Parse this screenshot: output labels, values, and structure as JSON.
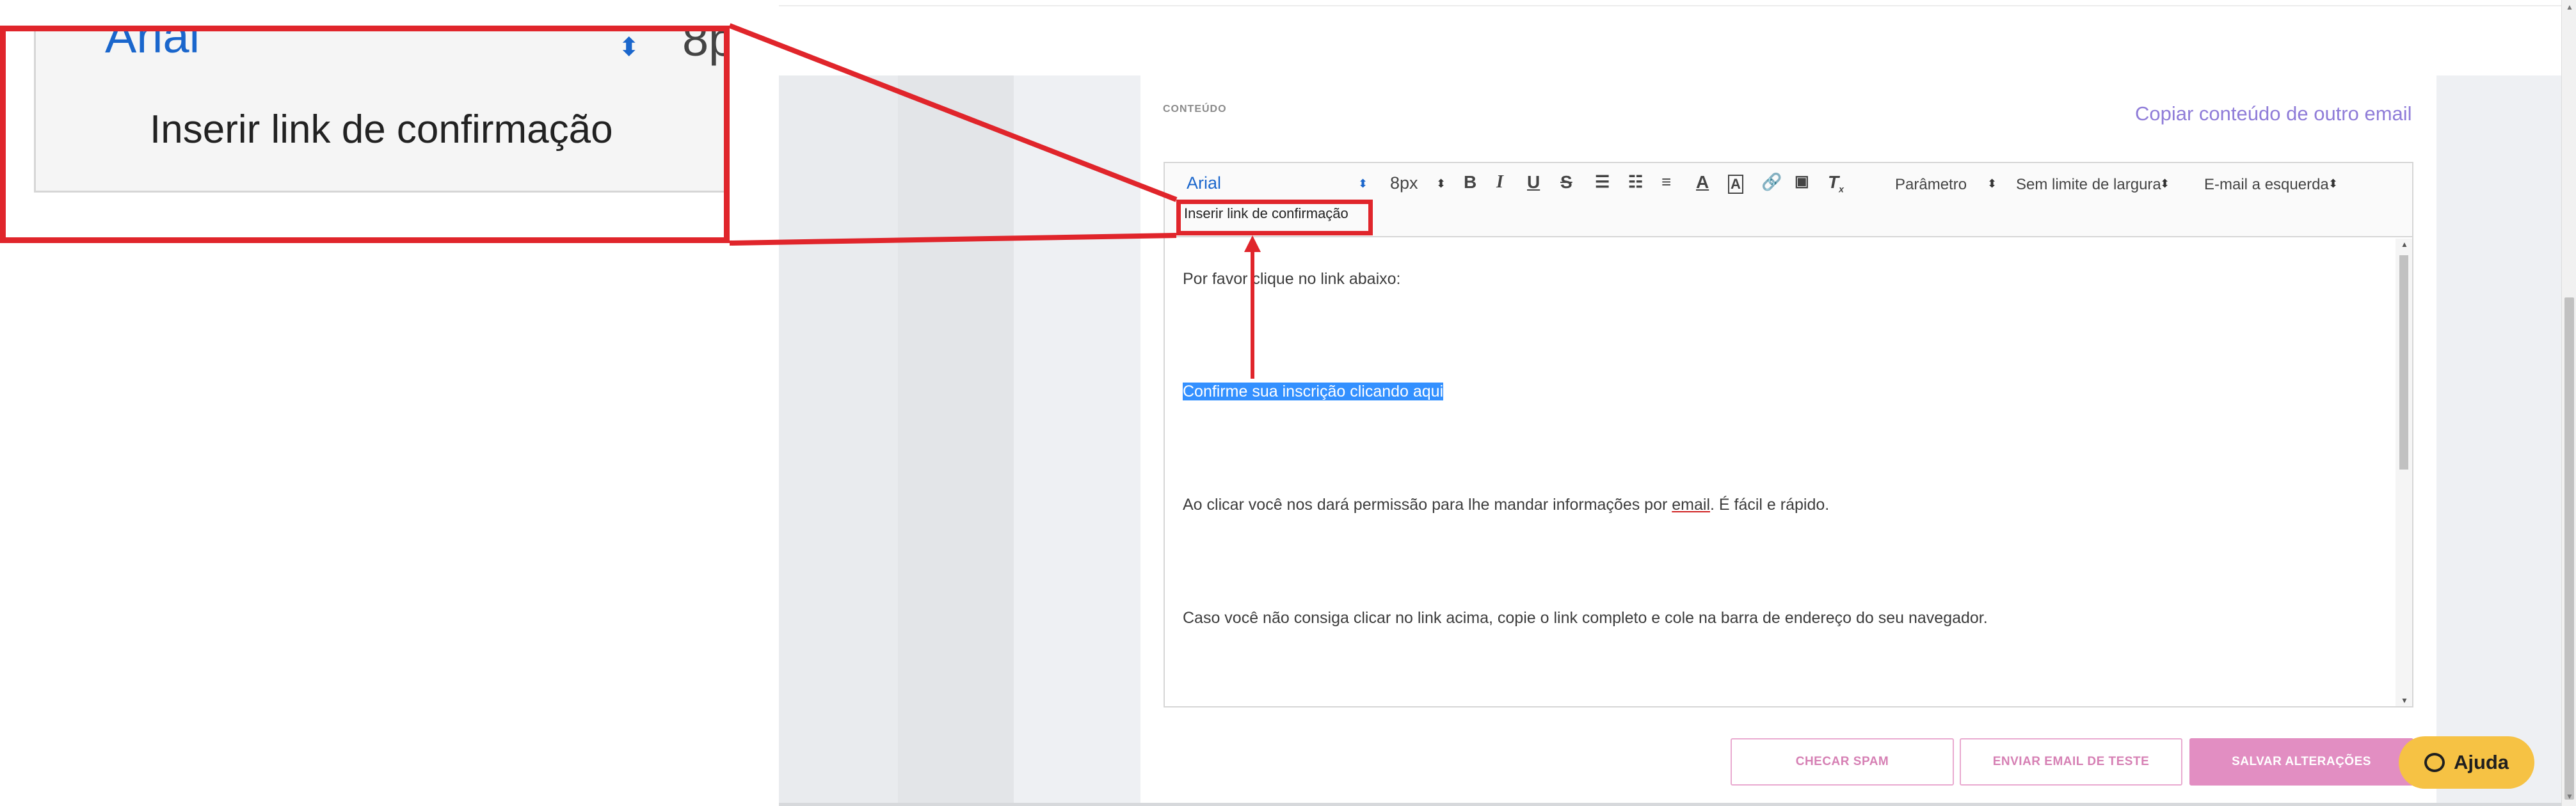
{
  "section": {
    "label": "CONTEÚDO",
    "copy_link": "Copiar conteúdo de outro email"
  },
  "toolbar": {
    "font": "Arial",
    "size": "8px",
    "param": "Parâmetro",
    "width": "Sem limite de largura",
    "align": "E-mail a esquerda",
    "insert_confirm": "Inserir link de confirmação"
  },
  "content": {
    "p1": "Por favor clique no link abaixo:",
    "p2": "Confirme sua inscrição clicando aqui",
    "p3_before": "Ao clicar você nos dará permissão para lhe mandar informações por ",
    "p3_email": "email",
    "p3_after": ". É fácil e rápido.",
    "p4": "Caso você não consiga clicar no link acima, copie o link completo e cole na barra de endereço do seu navegador."
  },
  "buttons": {
    "spam": "CHECAR SPAM",
    "test": "ENVIAR EMAIL DE TESTE",
    "save": "SALVAR ALTERAÇÕES",
    "help": "Ajuda"
  },
  "zoom": {
    "font": "Arial",
    "size": "8p",
    "label": "Inserir link de confirmação"
  },
  "colors": {
    "annotation": "#e0252b",
    "accent_purple": "#8f7cd8",
    "button_pink": "#e28ec2",
    "help_yellow": "#f6c244",
    "selection": "#3390ff"
  }
}
